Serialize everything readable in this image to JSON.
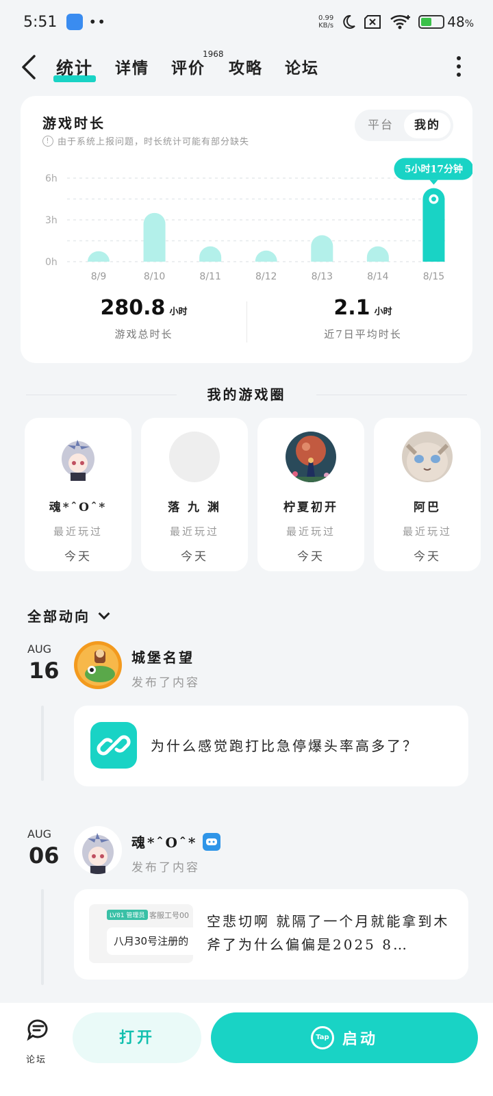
{
  "status": {
    "time": "5:51",
    "net_speed_value": "0.99",
    "net_speed_unit": "KB/s",
    "battery": "48",
    "battery_unit": "%",
    "battery_level": 0.48
  },
  "nav": {
    "tabs": [
      {
        "label": "统计",
        "active": true
      },
      {
        "label": "详情"
      },
      {
        "label": "评价",
        "badge": "1968"
      },
      {
        "label": "攻略"
      },
      {
        "label": "论坛"
      }
    ]
  },
  "stats": {
    "title": "游戏时长",
    "note": "由于系统上报问题，时长统计可能有部分缺失",
    "segment": [
      "平台",
      "我的"
    ],
    "selected_segment": "我的",
    "total_value": "280.8",
    "total_unit": "小时",
    "total_label": "游戏总时长",
    "avg_value": "2.1",
    "avg_unit": "小时",
    "avg_label": "近7日平均时长"
  },
  "chart_data": {
    "type": "bar",
    "categories": [
      "8/9",
      "8/10",
      "8/11",
      "8/12",
      "8/13",
      "8/14",
      "8/15"
    ],
    "values": [
      0.75,
      3.5,
      1.1,
      0.8,
      1.9,
      1.1,
      5.28
    ],
    "yticks": [
      "0h",
      "3h",
      "6h"
    ],
    "ylim": [
      0,
      6
    ],
    "highlight_index": 6,
    "highlight_label": "5小时17分钟",
    "colors": {
      "bar": "#b3f0ea",
      "highlight": "#19d3c5"
    },
    "grid": true
  },
  "circle": {
    "title": "我的游戏圈",
    "friends": [
      {
        "name": "魂*ˆOˆ*",
        "sub": "最近玩过",
        "when": "今天"
      },
      {
        "name": "落 九 渊",
        "sub": "最近玩过",
        "when": "今天"
      },
      {
        "name": "柠夏初开",
        "sub": "最近玩过",
        "when": "今天"
      },
      {
        "name": "阿巴",
        "sub": "最近玩过",
        "when": "今天"
      }
    ]
  },
  "feed": {
    "filter": "全部动向",
    "posts": [
      {
        "month": "AUG",
        "day": "16",
        "user": "城堡名望",
        "action": "发布了内容",
        "text": "为什么感觉跑打比急停爆头率高多了？"
      },
      {
        "month": "AUG",
        "day": "06",
        "user": "魂*ˆOˆ*",
        "action": "发布了内容",
        "text": "空悲切啊 就隔了一个月就能拿到木斧了为什么偏偏是2025 8…",
        "thumb_tag": "LV81 管理员",
        "thumb_id": "客服工号00",
        "thumb_text": "八月30号注册的"
      }
    ]
  },
  "bottom": {
    "forum_label": "论坛",
    "open_label": "打开",
    "start_label": "启动",
    "tap_logo": "Tap"
  }
}
